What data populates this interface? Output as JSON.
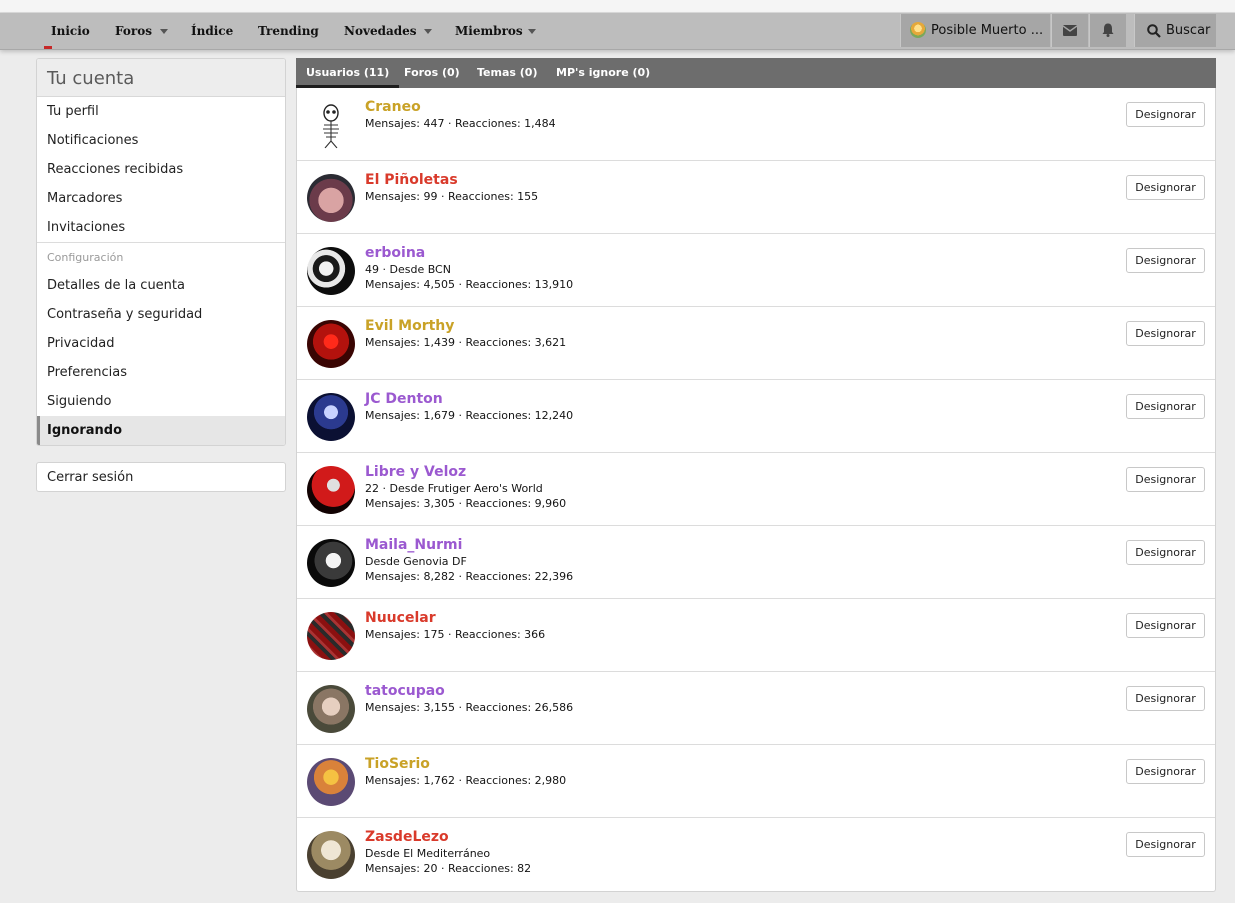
{
  "nav": {
    "items": [
      "Inicio",
      "Foros",
      "Índice",
      "Trending",
      "Novedades",
      "Miembros"
    ],
    "user_name": "Posible Muerto ...",
    "search_label": "Buscar"
  },
  "sidebar": {
    "title": "Tu cuenta",
    "group1": [
      "Tu perfil",
      "Notificaciones",
      "Reacciones recibidas",
      "Marcadores",
      "Invitaciones"
    ],
    "section_label": "Configuración",
    "group2": [
      "Detalles de la cuenta",
      "Contraseña y seguridad",
      "Privacidad",
      "Preferencias",
      "Siguiendo"
    ],
    "active_item": "Ignorando",
    "logout": "Cerrar sesión"
  },
  "tabs": [
    "Usuarios (11)",
    "Foros (0)",
    "Temas (0)",
    "MP's ignore (0)"
  ],
  "button_label": "Designorar",
  "colors": {
    "gold": "#c9a227",
    "red": "#d93a2b",
    "purple": "#9b59d0"
  },
  "users": [
    {
      "name": "Craneo",
      "color": "#c9a227",
      "lines": [
        "Mensajes: 447 · Reacciones: 1,484"
      ],
      "avatar": "skull-avatar"
    },
    {
      "name": "El Piñoletas",
      "color": "#d93a2b",
      "lines": [
        "Mensajes: 99 · Reacciones: 155"
      ],
      "avatar": "photo-avatar"
    },
    {
      "name": "erboina",
      "color": "#9b59d0",
      "lines": [
        "49 · Desde BCN",
        "Mensajes: 4,505 · Reacciones: 13,910"
      ],
      "avatar": "photo-avatar"
    },
    {
      "name": "Evil Morthy",
      "color": "#c9a227",
      "lines": [
        "Mensajes: 1,439 · Reacciones: 3,621"
      ],
      "avatar": "photo-avatar"
    },
    {
      "name": "JC Denton",
      "color": "#9b59d0",
      "lines": [
        "Mensajes: 1,679 · Reacciones: 12,240"
      ],
      "avatar": "photo-avatar"
    },
    {
      "name": "Libre y Veloz",
      "color": "#9b59d0",
      "lines": [
        "22 · Desde Frutiger Aero's World",
        "Mensajes: 3,305 · Reacciones: 9,960"
      ],
      "avatar": "photo-avatar"
    },
    {
      "name": "Maila_Nurmi",
      "color": "#9b59d0",
      "lines": [
        "Desde Genovia DF",
        "Mensajes: 8,282 · Reacciones: 22,396"
      ],
      "avatar": "photo-avatar"
    },
    {
      "name": "Nuucelar",
      "color": "#d93a2b",
      "lines": [
        "Mensajes: 175 · Reacciones: 366"
      ],
      "avatar": "photo-avatar"
    },
    {
      "name": "tatocupao",
      "color": "#9b59d0",
      "lines": [
        "Mensajes: 3,155 · Reacciones: 26,586"
      ],
      "avatar": "photo-avatar"
    },
    {
      "name": "TioSerio",
      "color": "#c9a227",
      "lines": [
        "Mensajes: 1,762 · Reacciones: 2,980"
      ],
      "avatar": "photo-avatar"
    },
    {
      "name": "ZasdeLezo",
      "color": "#d93a2b",
      "lines": [
        "Desde El Mediterráneo",
        "Mensajes: 20 · Reacciones: 82"
      ],
      "avatar": "photo-avatar"
    }
  ]
}
